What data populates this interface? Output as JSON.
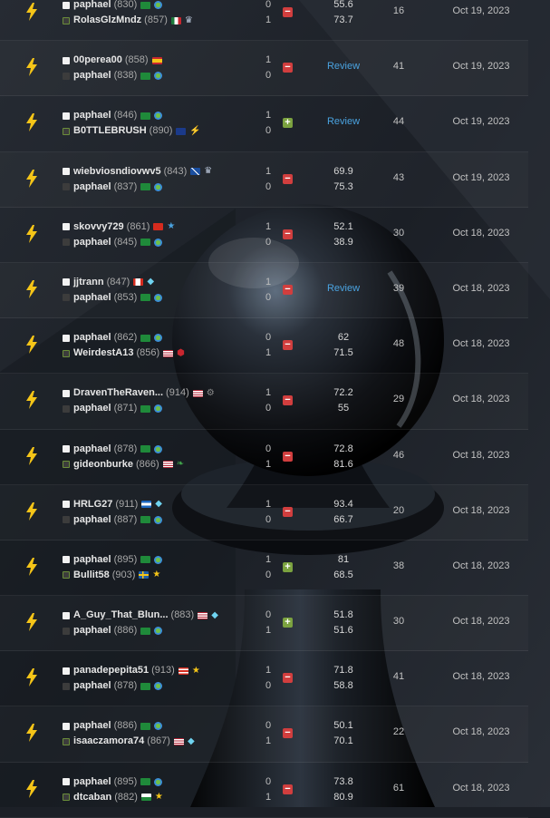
{
  "colors": {
    "win": "#7ba23f",
    "loss": "#d13e3e",
    "review_link": "#4aa3e0",
    "time_control_icon": "#f5c518"
  },
  "games": [
    {
      "time_control_icon": "lightning-bolt-icon",
      "players": [
        {
          "name": "paphael",
          "rating": "(830)",
          "color": "white",
          "flags": [
            "brazil",
            "globe"
          ]
        },
        {
          "name": "RolasGlzMndz",
          "rating": "(857)",
          "color": "black",
          "flags": [
            "mexico",
            "crown"
          ]
        }
      ],
      "scores": [
        "0",
        "1"
      ],
      "result": "loss",
      "result_symbol": "−",
      "accuracy": [
        "55.6",
        "73.7"
      ],
      "review": null,
      "moves": "16",
      "date": "Oct 19, 2023"
    },
    {
      "time_control_icon": "lightning-bolt-icon",
      "players": [
        {
          "name": "00perea00",
          "rating": "(858)",
          "color": "white",
          "flags": [
            "spain"
          ]
        },
        {
          "name": "paphael",
          "rating": "(838)",
          "color": "black",
          "flags": [
            "brazil",
            "globe"
          ]
        }
      ],
      "scores": [
        "1",
        "0"
      ],
      "result": "loss",
      "result_symbol": "−",
      "accuracy": null,
      "review": "Review",
      "moves": "41",
      "date": "Oct 19, 2023"
    },
    {
      "time_control_icon": "lightning-bolt-icon",
      "players": [
        {
          "name": "paphael",
          "rating": "(846)",
          "color": "white",
          "flags": [
            "brazil",
            "globe"
          ]
        },
        {
          "name": "B0TTLEBRUSH",
          "rating": "(890)",
          "color": "black",
          "flags": [
            "australia",
            "bolt"
          ]
        }
      ],
      "scores": [
        "1",
        "0"
      ],
      "result": "win",
      "result_symbol": "+",
      "accuracy": null,
      "review": "Review",
      "moves": "44",
      "date": "Oct 19, 2023"
    },
    {
      "time_control_icon": "lightning-bolt-icon",
      "players": [
        {
          "name": "wiebviosndiovwv5",
          "rating": "(843)",
          "color": "white",
          "flags": [
            "scotland",
            "crown"
          ]
        },
        {
          "name": "paphael",
          "rating": "(837)",
          "color": "black",
          "flags": [
            "brazil",
            "globe"
          ]
        }
      ],
      "scores": [
        "1",
        "0"
      ],
      "result": "loss",
      "result_symbol": "−",
      "accuracy": [
        "69.9",
        "75.3"
      ],
      "review": null,
      "moves": "43",
      "date": "Oct 19, 2023"
    },
    {
      "time_control_icon": "lightning-bolt-icon",
      "players": [
        {
          "name": "skovvy729",
          "rating": "(861)",
          "color": "white",
          "flags": [
            "switzerland",
            "star-blue"
          ]
        },
        {
          "name": "paphael",
          "rating": "(845)",
          "color": "black",
          "flags": [
            "brazil",
            "globe"
          ]
        }
      ],
      "scores": [
        "1",
        "0"
      ],
      "result": "loss",
      "result_symbol": "−",
      "accuracy": [
        "52.1",
        "38.9"
      ],
      "review": null,
      "moves": "30",
      "date": "Oct 18, 2023"
    },
    {
      "time_control_icon": "lightning-bolt-icon",
      "players": [
        {
          "name": "jjtrann",
          "rating": "(847)",
          "color": "white",
          "flags": [
            "canada",
            "diamond"
          ]
        },
        {
          "name": "paphael",
          "rating": "(853)",
          "color": "black",
          "flags": [
            "brazil",
            "globe"
          ]
        }
      ],
      "scores": [
        "1",
        "0"
      ],
      "result": "loss",
      "result_symbol": "−",
      "accuracy": null,
      "review": "Review",
      "moves": "39",
      "date": "Oct 18, 2023"
    },
    {
      "time_control_icon": "lightning-bolt-icon",
      "players": [
        {
          "name": "paphael",
          "rating": "(862)",
          "color": "white",
          "flags": [
            "brazil",
            "globe"
          ]
        },
        {
          "name": "WeirdestA13",
          "rating": "(856)",
          "color": "black",
          "flags": [
            "usa",
            "shield"
          ]
        }
      ],
      "scores": [
        "0",
        "1"
      ],
      "result": "loss",
      "result_symbol": "−",
      "accuracy": [
        "62",
        "71.5"
      ],
      "review": null,
      "moves": "48",
      "date": "Oct 18, 2023"
    },
    {
      "time_control_icon": "lightning-bolt-icon",
      "players": [
        {
          "name": "DravenTheRaven...",
          "rating": "(914)",
          "color": "white",
          "flags": [
            "usa",
            "gear"
          ]
        },
        {
          "name": "paphael",
          "rating": "(871)",
          "color": "black",
          "flags": [
            "brazil",
            "globe"
          ]
        }
      ],
      "scores": [
        "1",
        "0"
      ],
      "result": "loss",
      "result_symbol": "−",
      "accuracy": [
        "72.2",
        "55"
      ],
      "review": null,
      "moves": "29",
      "date": "Oct 18, 2023"
    },
    {
      "time_control_icon": "lightning-bolt-icon",
      "players": [
        {
          "name": "paphael",
          "rating": "(878)",
          "color": "white",
          "flags": [
            "brazil",
            "globe"
          ]
        },
        {
          "name": "gideonburke",
          "rating": "(866)",
          "color": "black",
          "flags": [
            "usa",
            "leaf"
          ]
        }
      ],
      "scores": [
        "0",
        "1"
      ],
      "result": "loss",
      "result_symbol": "−",
      "accuracy": [
        "72.8",
        "81.6"
      ],
      "review": null,
      "moves": "46",
      "date": "Oct 18, 2023"
    },
    {
      "time_control_icon": "lightning-bolt-icon",
      "players": [
        {
          "name": "HRLG27",
          "rating": "(911)",
          "color": "white",
          "flags": [
            "honduras",
            "diamond"
          ]
        },
        {
          "name": "paphael",
          "rating": "(887)",
          "color": "black",
          "flags": [
            "brazil",
            "globe"
          ]
        }
      ],
      "scores": [
        "1",
        "0"
      ],
      "result": "loss",
      "result_symbol": "−",
      "accuracy": [
        "93.4",
        "66.7"
      ],
      "review": null,
      "moves": "20",
      "date": "Oct 18, 2023"
    },
    {
      "time_control_icon": "lightning-bolt-icon",
      "players": [
        {
          "name": "paphael",
          "rating": "(895)",
          "color": "white",
          "flags": [
            "brazil",
            "globe"
          ]
        },
        {
          "name": "Bullit58",
          "rating": "(903)",
          "color": "black",
          "flags": [
            "sweden",
            "star"
          ]
        }
      ],
      "scores": [
        "1",
        "0"
      ],
      "result": "win",
      "result_symbol": "+",
      "accuracy": [
        "81",
        "68.5"
      ],
      "review": null,
      "moves": "38",
      "date": "Oct 18, 2023"
    },
    {
      "time_control_icon": "lightning-bolt-icon",
      "players": [
        {
          "name": "A_Guy_That_Blun...",
          "rating": "(883)",
          "color": "white",
          "flags": [
            "usa",
            "diamond"
          ]
        },
        {
          "name": "paphael",
          "rating": "(886)",
          "color": "black",
          "flags": [
            "brazil",
            "globe"
          ]
        }
      ],
      "scores": [
        "0",
        "1"
      ],
      "result": "win",
      "result_symbol": "+",
      "accuracy": [
        "51.8",
        "51.6"
      ],
      "review": null,
      "moves": "30",
      "date": "Oct 18, 2023"
    },
    {
      "time_control_icon": "lightning-bolt-icon",
      "players": [
        {
          "name": "panadepepita51",
          "rating": "(913)",
          "color": "white",
          "flags": [
            "puerto-rico",
            "star"
          ]
        },
        {
          "name": "paphael",
          "rating": "(878)",
          "color": "black",
          "flags": [
            "brazil",
            "globe"
          ]
        }
      ],
      "scores": [
        "1",
        "0"
      ],
      "result": "loss",
      "result_symbol": "−",
      "accuracy": [
        "71.8",
        "58.8"
      ],
      "review": null,
      "moves": "41",
      "date": "Oct 18, 2023"
    },
    {
      "time_control_icon": "lightning-bolt-icon",
      "players": [
        {
          "name": "paphael",
          "rating": "(886)",
          "color": "white",
          "flags": [
            "brazil",
            "globe"
          ]
        },
        {
          "name": "isaaczamora74",
          "rating": "(867)",
          "color": "black",
          "flags": [
            "usa",
            "diamond"
          ]
        }
      ],
      "scores": [
        "0",
        "1"
      ],
      "result": "loss",
      "result_symbol": "−",
      "accuracy": [
        "50.1",
        "70.1"
      ],
      "review": null,
      "moves": "22",
      "date": "Oct 18, 2023"
    },
    {
      "time_control_icon": "lightning-bolt-icon",
      "players": [
        {
          "name": "paphael",
          "rating": "(895)",
          "color": "white",
          "flags": [
            "brazil",
            "globe"
          ]
        },
        {
          "name": "dtcaban",
          "rating": "(882)",
          "color": "black",
          "flags": [
            "wales",
            "star"
          ]
        }
      ],
      "scores": [
        "0",
        "1"
      ],
      "result": "loss",
      "result_symbol": "−",
      "accuracy": [
        "73.8",
        "80.9"
      ],
      "review": null,
      "moves": "61",
      "date": "Oct 18, 2023"
    }
  ]
}
